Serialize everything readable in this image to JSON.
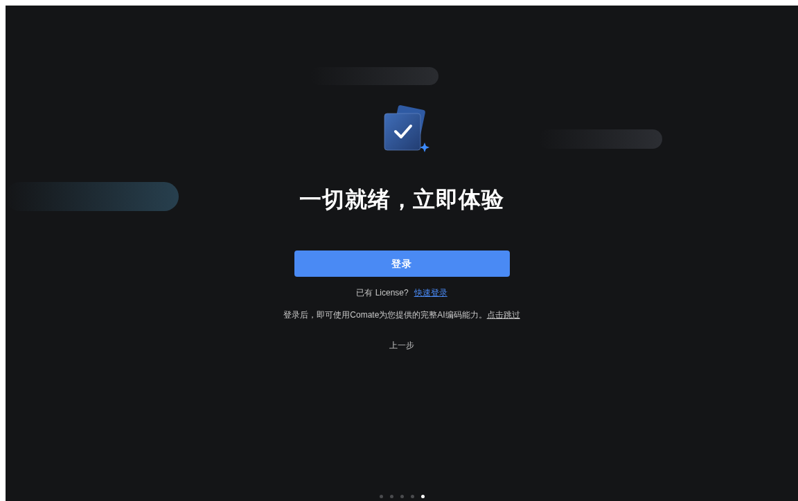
{
  "title": "一切就绪，立即体验",
  "login_button": "登录",
  "license_prompt": {
    "text": "已有 License?",
    "link": "快速登录"
  },
  "skip_note": {
    "text": "登录后，即可使用Comate为您提供的完整AI编码能力。",
    "link": "点击跳过"
  },
  "back_link": "上一步",
  "steps": [
    {
      "selected": false
    },
    {
      "selected": false
    },
    {
      "selected": false
    },
    {
      "selected": false
    },
    {
      "selected": true
    }
  ]
}
